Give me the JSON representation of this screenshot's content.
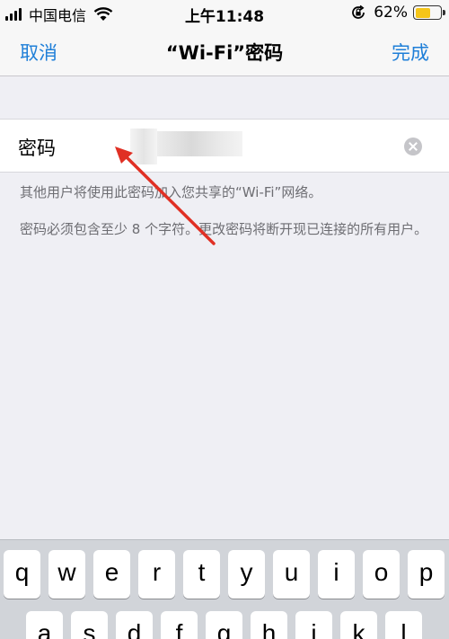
{
  "status_bar": {
    "carrier": "中国电信",
    "time": "上午11:48",
    "battery_percent": "62%",
    "battery_level": 0.62,
    "battery_color": "#f5c518"
  },
  "nav": {
    "cancel": "取消",
    "title": "“Wi-Fi”密码",
    "done": "完成",
    "accent_color": "#1f7fd8"
  },
  "password_field": {
    "label": "密码",
    "value": ""
  },
  "help": {
    "line1": "其他用户将使用此密码加入您共享的“Wi-Fi”网络。",
    "line2": "密码必须包含至少 8 个字符。更改密码将断开现已连接的所有用户。"
  },
  "keyboard": {
    "row1": [
      "q",
      "w",
      "e",
      "r",
      "t",
      "y",
      "u",
      "i",
      "o",
      "p"
    ],
    "row2": [
      "a",
      "s",
      "d",
      "f",
      "g",
      "h",
      "j",
      "k",
      "l"
    ]
  },
  "annotation_color": "#e03024"
}
